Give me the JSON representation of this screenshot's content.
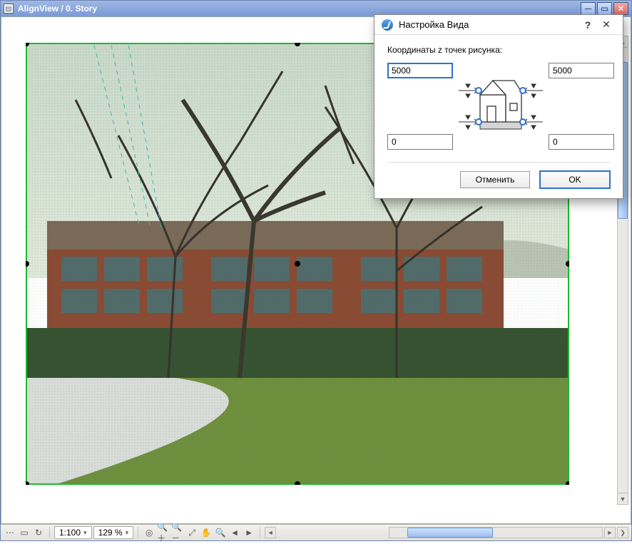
{
  "window": {
    "title": "AlignView / 0. Story"
  },
  "statusbar": {
    "scale": "1:100",
    "zoom": "129 %"
  },
  "dialog": {
    "title": "Настройка Вида",
    "label": "Координаты z точек рисунка:",
    "z_top_left": "5000",
    "z_top_right": "5000",
    "z_bottom_left": "0",
    "z_bottom_right": "0",
    "cancel": "Отменить",
    "ok": "OK"
  }
}
